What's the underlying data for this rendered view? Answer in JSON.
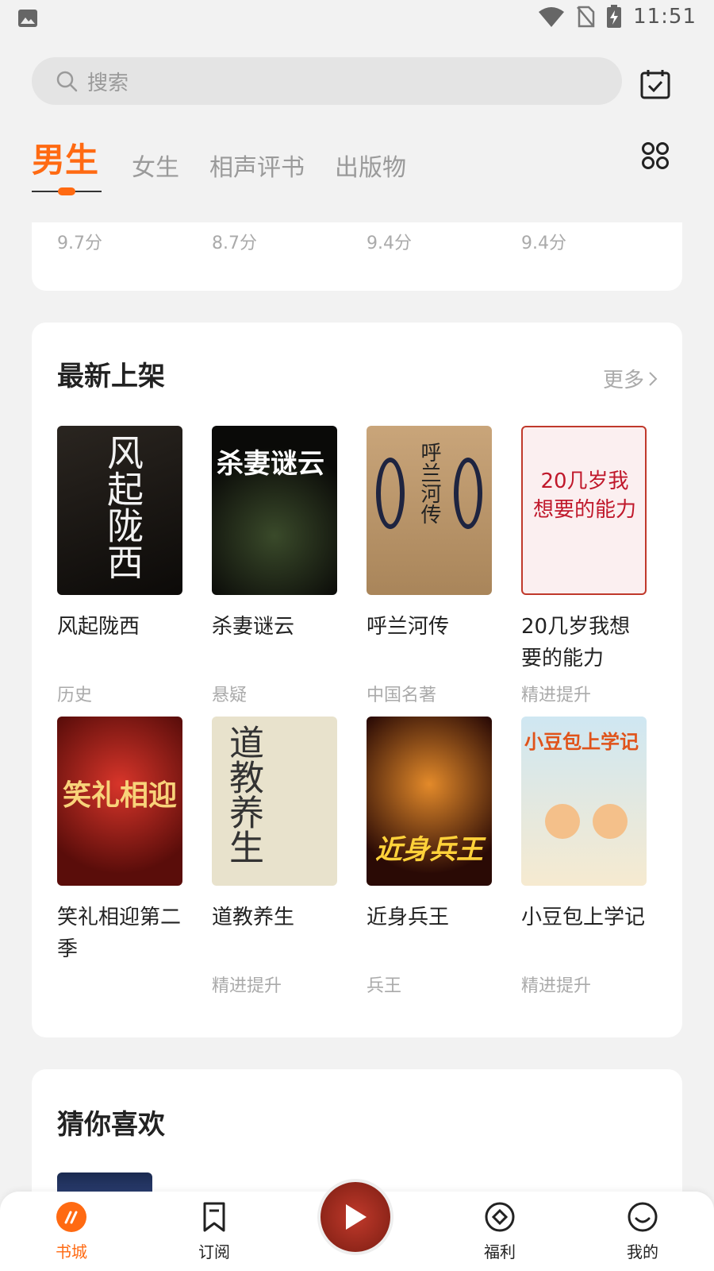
{
  "status": {
    "time": "11:51"
  },
  "search": {
    "placeholder": "搜索"
  },
  "tabs": [
    {
      "label": "男生",
      "active": true
    },
    {
      "label": "女生"
    },
    {
      "label": "相声评书"
    },
    {
      "label": "出版物"
    }
  ],
  "top_scores": [
    "9.7分",
    "8.7分",
    "9.4分",
    "9.4分"
  ],
  "new_section": {
    "title": "最新上架",
    "more": "更多",
    "books": [
      {
        "title": "风起陇西",
        "tag": "历史",
        "cover_text": "风起陇西"
      },
      {
        "title": "杀妻谜云",
        "tag": "悬疑",
        "cover_text": "杀妻谜云"
      },
      {
        "title": "呼兰河传",
        "tag": "中国名著",
        "cover_text": "呼兰河传"
      },
      {
        "title": "20几岁我想要的能力",
        "tag": "精进提升",
        "cover_text": "20几岁我想要的能力"
      },
      {
        "title": "笑礼相迎第二季",
        "tag": "",
        "cover_text": "笑礼相迎"
      },
      {
        "title": "道教养生",
        "tag": "精进提升",
        "cover_text": "道教养生"
      },
      {
        "title": "近身兵王",
        "tag": "兵王",
        "cover_text": "近身兵王"
      },
      {
        "title": "小豆包上学记",
        "tag": "精进提升",
        "cover_text": "小豆包上学记"
      }
    ]
  },
  "guess_section": {
    "title": "猜你喜欢"
  },
  "nav": [
    {
      "label": "书城",
      "icon": "bookstore-icon"
    },
    {
      "label": "订阅",
      "icon": "bookmark-icon"
    },
    {
      "label": "福利",
      "icon": "welfare-icon"
    },
    {
      "label": "我的",
      "icon": "smile-icon"
    }
  ],
  "colors": {
    "accent": "#ff6a12"
  }
}
